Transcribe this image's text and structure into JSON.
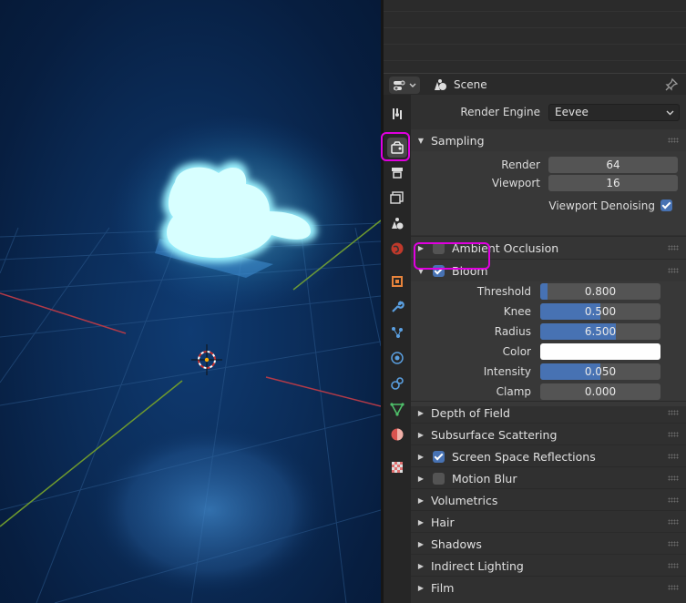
{
  "header": {
    "scene_label": "Scene"
  },
  "render_engine": {
    "label": "Render Engine",
    "value": "Eevee"
  },
  "sampling": {
    "title": "Sampling",
    "render_label": "Render",
    "render_value": "64",
    "viewport_label": "Viewport",
    "viewport_value": "16",
    "denoise_label": "Viewport Denoising",
    "denoise_checked": true
  },
  "ambient_occlusion": {
    "title": "Ambient Occlusion",
    "checked": false
  },
  "bloom": {
    "title": "Bloom",
    "checked": true,
    "threshold_label": "Threshold",
    "threshold_value": "0.800",
    "threshold_fill": 0.06,
    "knee_label": "Knee",
    "knee_value": "0.500",
    "knee_fill": 0.5,
    "radius_label": "Radius",
    "radius_value": "6.500",
    "radius_fill": 0.63,
    "color_label": "Color",
    "color_value": "#ffffff",
    "intensity_label": "Intensity",
    "intensity_value": "0.050",
    "intensity_fill": 0.5,
    "clamp_label": "Clamp",
    "clamp_value": "0.000",
    "clamp_fill": 0
  },
  "panels": {
    "depth_of_field": "Depth of Field",
    "subsurface_scattering": "Subsurface Scattering",
    "screen_space_reflections": "Screen Space Reflections",
    "motion_blur": "Motion Blur",
    "volumetrics": "Volumetrics",
    "hair": "Hair",
    "shadows": "Shadows",
    "indirect_lighting": "Indirect Lighting",
    "film": "Film"
  },
  "checkbox_states": {
    "screen_space_reflections": true,
    "motion_blur": false
  },
  "colors": {
    "accent_blue": "#4772b3",
    "highlight_magenta": "#e000e0"
  }
}
